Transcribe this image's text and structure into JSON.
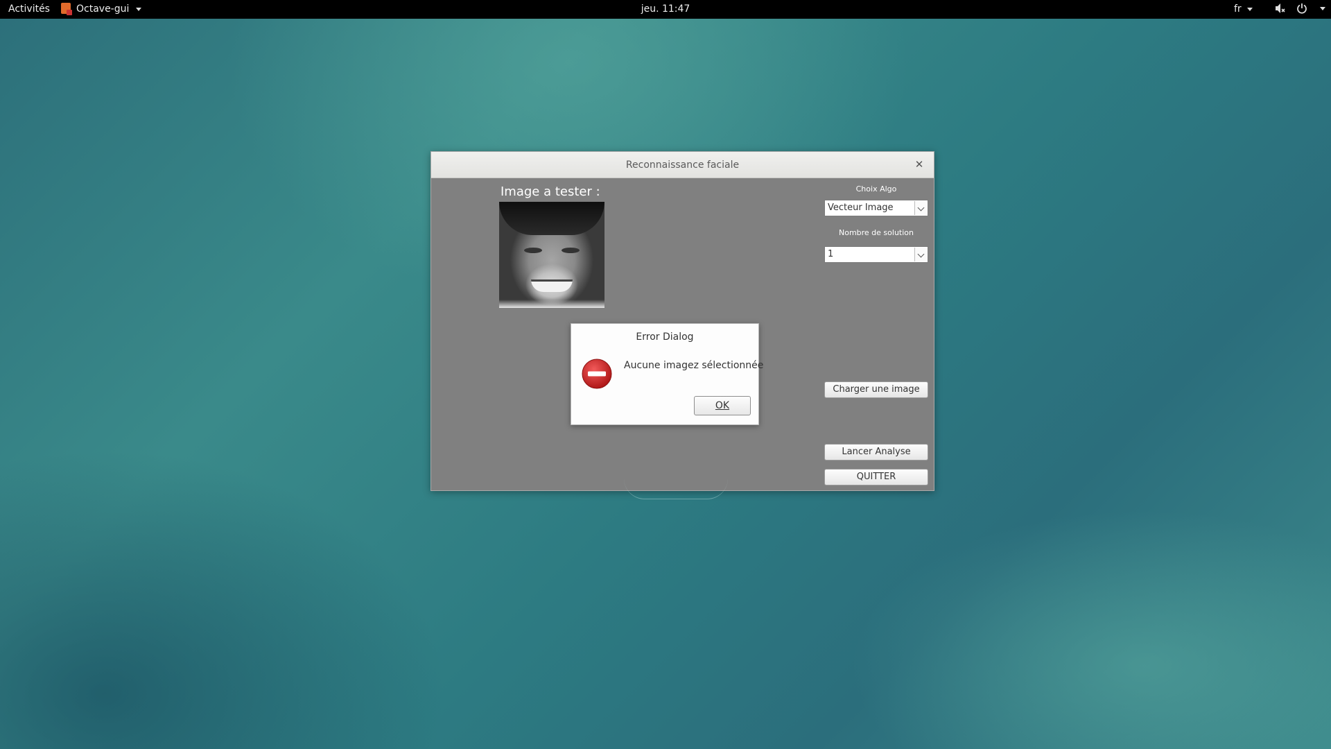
{
  "topbar": {
    "activities": "Activités",
    "app_menu": "Octave-gui",
    "clock": "jeu. 11:47",
    "language": "fr"
  },
  "window": {
    "title": "Reconnaissance faciale",
    "image_label": "Image a tester :",
    "algo_label": "Choix Algo",
    "algo_value": "Vecteur Image",
    "solution_label": "Nombre de solution",
    "solution_value": "1",
    "load_button": "Charger une image",
    "analyze_button": "Lancer Analyse",
    "quit_button": "QUITTER"
  },
  "error_dialog": {
    "title": "Error Dialog",
    "message": "Aucune imagez sélectionnée",
    "ok_button": "OK"
  },
  "colors": {
    "topbar_bg": "#000000",
    "window_body": "#808080",
    "error_icon": "#d42f2f"
  }
}
